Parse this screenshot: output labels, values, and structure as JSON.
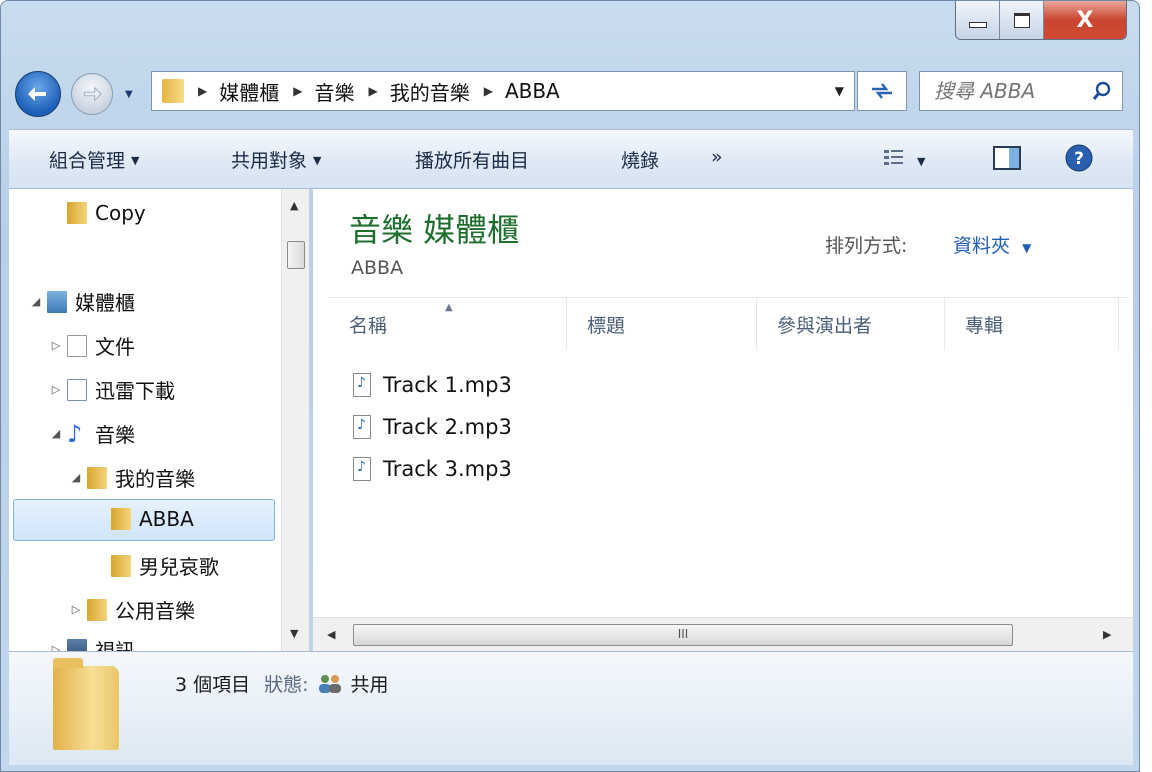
{
  "window": {
    "title_buttons": {
      "minimize": "—",
      "maximize": "□",
      "close": "X"
    }
  },
  "address_bar": {
    "breadcrumbs": [
      "媒體櫃",
      "音樂",
      "我的音樂",
      "ABBA"
    ]
  },
  "search": {
    "placeholder": "搜尋 ABBA"
  },
  "command_bar": {
    "organize": "組合管理",
    "share_with": "共用對象",
    "play_all": "播放所有曲目",
    "burn": "燒錄",
    "more": "»"
  },
  "nav_pane": {
    "items": [
      {
        "label": "Copy"
      },
      {
        "label": "媒體櫃"
      },
      {
        "label": "文件"
      },
      {
        "label": "迅雷下載"
      },
      {
        "label": "音樂"
      },
      {
        "label": "我的音樂"
      },
      {
        "label": "ABBA"
      },
      {
        "label": "男兒哀歌"
      },
      {
        "label": "公用音樂"
      },
      {
        "label": "視訊"
      }
    ]
  },
  "content": {
    "library_title": "音樂 媒體櫃",
    "library_subtitle": "ABBA",
    "arrange_label": "排列方式:",
    "arrange_value": "資料夾",
    "columns": [
      "名稱",
      "標題",
      "參與演出者",
      "專輯"
    ],
    "files": [
      {
        "name": "Track 1.mp3"
      },
      {
        "name": "Track 2.mp3"
      },
      {
        "name": "Track 3.mp3"
      }
    ],
    "hscroll_grip": "III"
  },
  "details": {
    "count": "3 個項目",
    "state_label": "狀態:",
    "state_value": "共用"
  },
  "icons": {
    "back": "arrow-left-icon",
    "forward": "arrow-right-icon",
    "refresh": "refresh-icon",
    "search": "search-icon",
    "help": "help-icon",
    "preview": "preview-pane-icon",
    "views": "view-list-icon"
  },
  "colors": {
    "library_title": "#1e6f2e",
    "accent_link": "#1f5fb7"
  }
}
